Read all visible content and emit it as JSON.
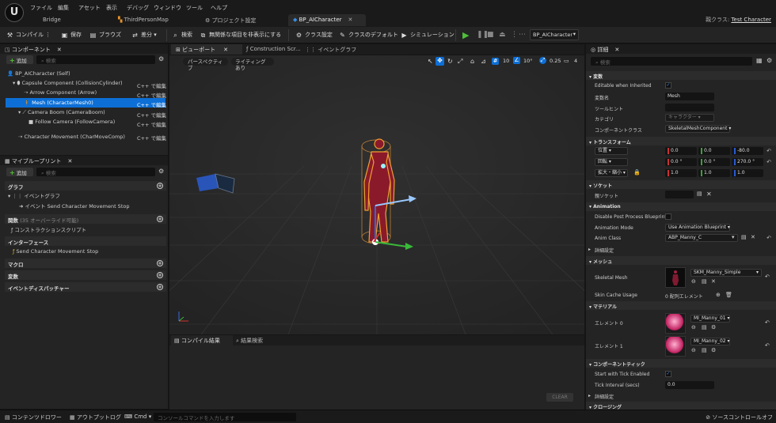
{
  "menu": [
    "ファイル",
    "編集",
    "アセット",
    "表示",
    "デバッグ",
    "ウィンドウ",
    "ツール",
    "ヘルプ"
  ],
  "tabs": [
    {
      "label": "Bridge"
    },
    {
      "label": "ThirdPersonMap"
    },
    {
      "label": "プロジェクト設定"
    },
    {
      "label": "BP_AICharacter"
    }
  ],
  "parent_class": {
    "label": "親クラス:",
    "value": "Test Character"
  },
  "toolbar": {
    "compile": "コンパイル",
    "save": "保存",
    "browse": "ブラウズ",
    "diff": "差分",
    "find": "検索",
    "hide_unrelated": "無関係な項目を非表示にする",
    "class_settings": "クラス設定",
    "class_defaults": "クラスのデフォルト",
    "simulation": "シミュレーション",
    "blueprint_select": "BP_AICharacter"
  },
  "components": {
    "title": "コンポーネント",
    "add": "追加",
    "search_placeholder": "検索",
    "items": [
      {
        "label": "BP_AICharacter (Self)",
        "cpp": ""
      },
      {
        "label": "Capsule Component (CollisionCylinder)",
        "cpp": "C++ で編集"
      },
      {
        "label": "Arrow Component (Arrow)",
        "cpp": "C++ で編集"
      },
      {
        "label": "Mesh (CharacterMesh0)",
        "cpp": "C++ で編集"
      },
      {
        "label": "Camera Boom (CameraBoom)",
        "cpp": "C++ で編集"
      },
      {
        "label": "Follow Camera (FollowCamera)",
        "cpp": "C++ で編集"
      },
      {
        "label": "Character Movement (CharMoveComp)",
        "cpp": "C++ で編集"
      }
    ]
  },
  "my_blueprint": {
    "title": "マイブループリント",
    "add": "追加",
    "search_placeholder": "検索",
    "sections": {
      "graph": "グラフ",
      "event_graph": "イベントグラフ",
      "event_item": "イベント Send Character Movement Stop",
      "functions": "関数",
      "functions_note": "(35 オーバーライド可能)",
      "construction": "コンストラクションスクリプト",
      "interfaces": "インターフェース",
      "interface_item": "Send Character Movement Stop",
      "macros": "マクロ",
      "variables": "変数",
      "dispatchers": "イベントディスパッチャー"
    }
  },
  "viewport_tabs": {
    "viewport": "ビューポート",
    "construction": "Construction Scr...",
    "event_graph": "イベントグラフ"
  },
  "viewport": {
    "perspective": "パースペクティブ",
    "lighting": "ライティングあり",
    "grid": "10",
    "angle": "10°",
    "scale": "0.25",
    "speed": "4"
  },
  "bottom_tabs": {
    "compile_results": "コンパイル結果",
    "find_results": "結果検索",
    "clear": "CLEAR"
  },
  "details": {
    "title": "詳細",
    "search_placeholder": "検索",
    "variable": "変数",
    "editable": "Editable when Inherited",
    "var_name": "変数名",
    "var_name_value": "Mesh",
    "tooltip": "ツールヒント",
    "category": "カテゴリ",
    "category_value": "キャラクター",
    "component_class": "コンポーネントクラス",
    "component_class_value": "SkeletalMeshComponent",
    "transform": "トランスフォーム",
    "location": "位置",
    "rotation": "回転",
    "scale": "拡大・縮小",
    "loc": [
      "0.0",
      "0.0",
      "-80.0"
    ],
    "rot": [
      "0.0 °",
      "0.0 °",
      "270.0 °"
    ],
    "scl": [
      "1.0",
      "1.0",
      "1.0"
    ],
    "socket": "ソケット",
    "parent_socket": "親ソケット",
    "animation": "Animation",
    "disable_pp": "Disable Post Process Blueprint",
    "anim_mode": "Animation Mode",
    "anim_mode_value": "Use Animation Blueprint",
    "anim_class": "Anim Class",
    "anim_class_value": "ABP_Manny_C",
    "advanced": "詳細設定",
    "mesh": "メッシュ",
    "skeletal_mesh": "Skeletal Mesh",
    "skeletal_mesh_value": "SKM_Manny_Simple",
    "skin_cache": "Skin Cache Usage",
    "skin_cache_value": "0 配列エレメント",
    "materials": "マテリアル",
    "element0": "エレメント 0",
    "element0_value": "MI_Manny_01",
    "element1": "エレメント 1",
    "element1_value": "MI_Manny_02",
    "tick": "コンポーネントティック",
    "start_tick": "Start with Tick Enabled",
    "tick_interval": "Tick Interval (secs)",
    "tick_interval_value": "0.0",
    "advanced2": "詳細設定",
    "cloth": "クロージング"
  },
  "statusbar": {
    "content_drawer": "コンテンツドロワー",
    "output_log": "アウトプットログ",
    "cmd": "Cmd",
    "console_placeholder": "コンソールコマンドを入力します",
    "source_control": "ソースコントロールオフ"
  },
  "colors": {
    "accent": "#0d6fd6",
    "play": "#4fbf3a",
    "orange": "#e8922a"
  }
}
